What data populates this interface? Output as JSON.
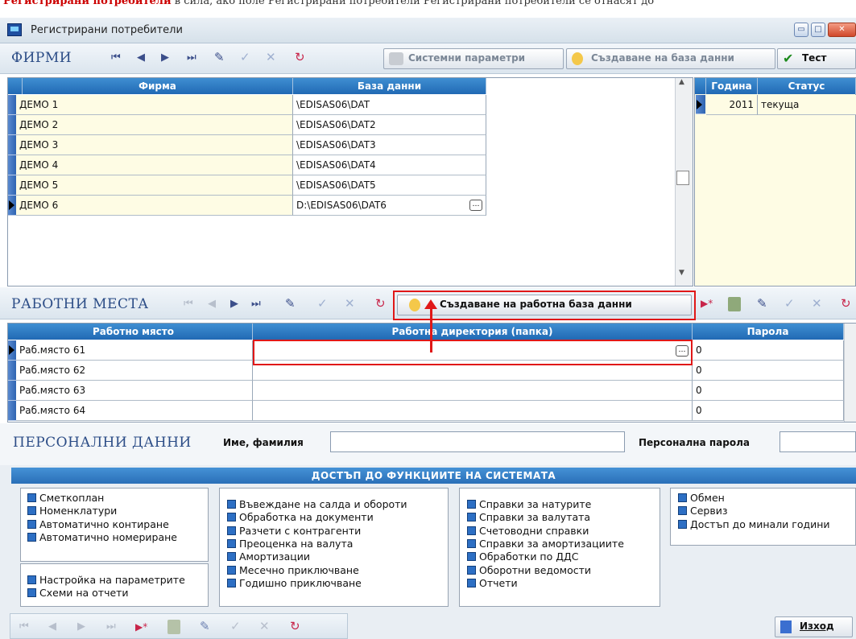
{
  "top_strip": {
    "text_plain": "Регистрирани потребители",
    "text_extra": "в сила, ако поле Регистрирани потребители Регистрирани потребители се отнасят до"
  },
  "window": {
    "title": "Регистрирани потребители",
    "btn_min": "▭",
    "btn_max": "□",
    "btn_close": "✕"
  },
  "firms": {
    "title": "ФИРМИ",
    "btn_system": "Системни параметри",
    "btn_create_db": "Създаване на база данни",
    "btn_test": "Тест",
    "columns": [
      "Фирма",
      "База данни"
    ],
    "rows": [
      {
        "name": "ДЕМО 1",
        "db": "\\EDISAS06\\DAT"
      },
      {
        "name": "ДЕМО 2",
        "db": "\\EDISAS06\\DAT2"
      },
      {
        "name": "ДЕМО 3",
        "db": "\\EDISAS06\\DAT3"
      },
      {
        "name": "ДЕМО 4",
        "db": "\\EDISAS06\\DAT4"
      },
      {
        "name": "ДЕМО 5",
        "db": "\\EDISAS06\\DAT5"
      },
      {
        "name": "ДЕМО 6",
        "db": "D:\\EDISAS06\\DAT6"
      }
    ],
    "ellipsis": "…",
    "years_columns": [
      "Година",
      "Статус"
    ],
    "years": [
      {
        "year": "2011",
        "status": "текуща"
      }
    ]
  },
  "workplaces": {
    "title": "РАБОТНИ МЕСТА",
    "btn_create_workdb": "Създаване на работна база данни",
    "columns": [
      "Работно място",
      "Работна директория (папка)",
      "Парола"
    ],
    "rows": [
      {
        "name": "Раб.място 61",
        "dir": "",
        "pass": "0"
      },
      {
        "name": "Раб.място 62",
        "dir": "",
        "pass": "0"
      },
      {
        "name": "Раб.място 63",
        "dir": "",
        "pass": "0"
      },
      {
        "name": "Раб.място 64",
        "dir": "",
        "pass": "0"
      }
    ]
  },
  "personal": {
    "title": "ПЕРСОНАЛНИ ДАННИ",
    "name_label": "Име, фамилия",
    "name_value": "",
    "pass_label": "Персонална парола",
    "pass_value": ""
  },
  "functions": {
    "title": "ДОСТЪП ДО ФУНКЦИИТЕ НА СИСТЕМАТА",
    "col1": [
      "Сметкоплан",
      "Номенклатури",
      "Автоматично контиране",
      "Автоматично номериране"
    ],
    "col1b": [
      "Настройка на параметрите",
      "Схеми на отчети"
    ],
    "col2": [
      "Въвеждане на салда и обороти",
      "Обработка на документи",
      "Разчети с контрагенти",
      "Преоценка на валута",
      "Амортизации",
      "Месечно приключване",
      "Годишно приключване"
    ],
    "col3": [
      "Справки за натурите",
      "Справки за валутата",
      "Счетоводни справки",
      "Справки за амортизациите",
      "Обработки по ДДС",
      "Оборотни ведомости",
      "Отчети"
    ],
    "col4": [
      "Обмен",
      "Сервиз",
      "Достъп до минали години"
    ]
  },
  "exit_label": "Изход",
  "nav": {
    "first": "⏮",
    "prev": "◀",
    "next": "▶",
    "last": "⏭",
    "insert": "▶*",
    "delete": "🗑",
    "edit": "✎",
    "post": "✓",
    "cancel": "✕",
    "refresh": "↻"
  }
}
